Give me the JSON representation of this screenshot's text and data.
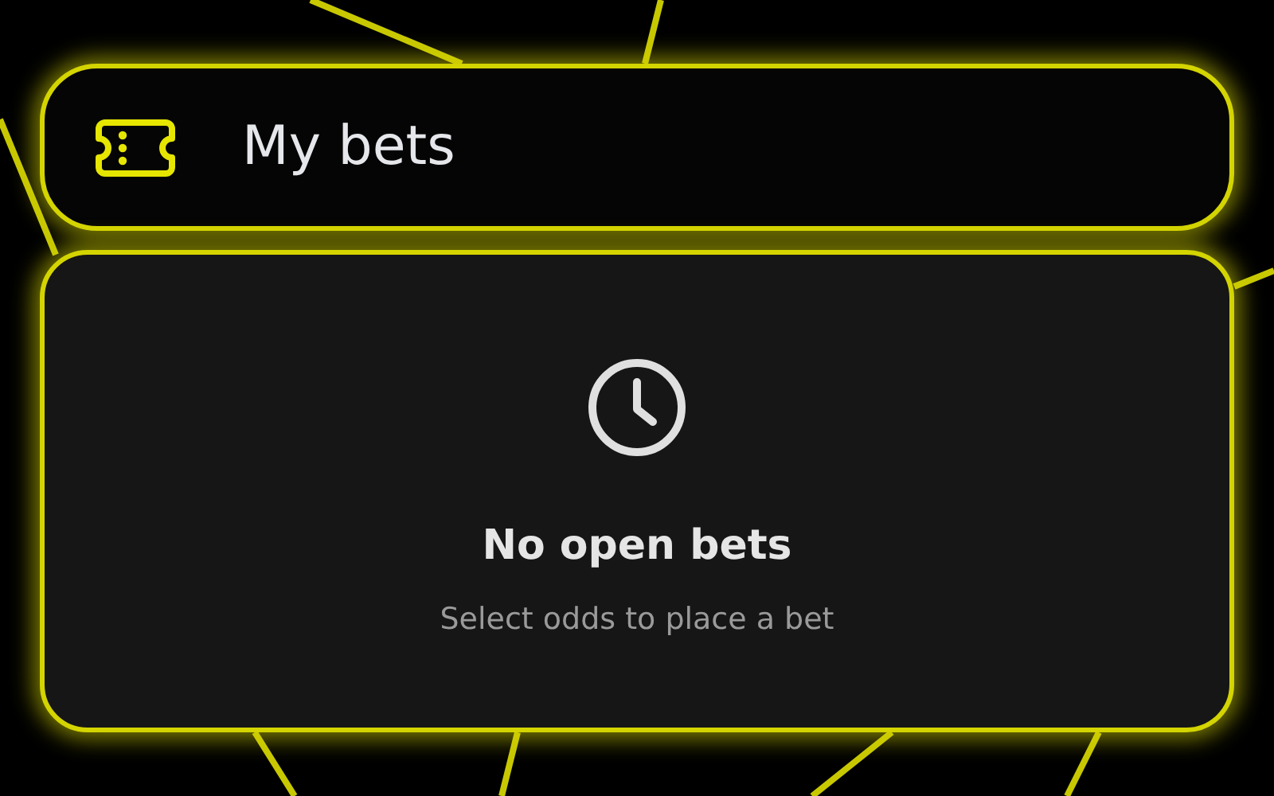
{
  "header": {
    "title": "My bets"
  },
  "empty_state": {
    "title": "No open bets",
    "message": "Select odds to place a bet"
  }
}
